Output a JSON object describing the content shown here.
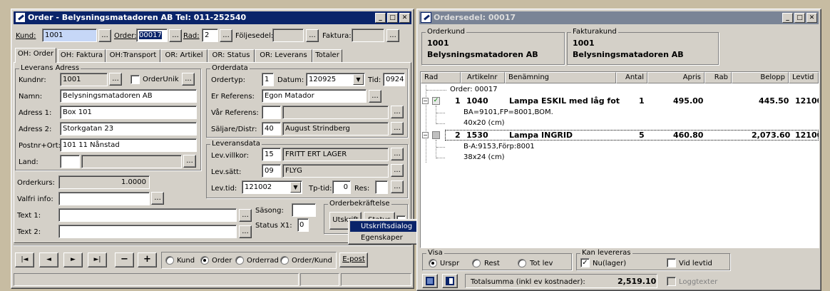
{
  "order_window": {
    "title": "Order - Belysningsmatadoren AB  Tel: 011-252540",
    "kund_label": "Kund:",
    "kund_value": "1001",
    "order_label": "Order:",
    "order_value": "00017",
    "rad_label": "Rad:",
    "rad_value": "2",
    "foljesedel_label": "Följesedel:",
    "faktura_label": "Faktura:",
    "tabs": [
      "OH: Order",
      "OH: Faktura",
      "OH:Transport",
      "OR: Artikel",
      "OR: Status",
      "OR: Leverans",
      "Totaler"
    ],
    "leverans": {
      "title": "Leverans Adress",
      "kundnr_label": "Kundnr:",
      "kundnr": "1001",
      "orderunik_label": "OrderUnik",
      "namn_label": "Namn:",
      "namn": "Belysningsmatadoren AB",
      "adress1_label": "Adress 1:",
      "adress1": "Box 101",
      "adress2_label": "Adress 2:",
      "adress2": "Storkgatan 23",
      "postnr_label": "Postnr+Ort:",
      "postnr": "101 11  Nånstad",
      "land_label": "Land:"
    },
    "orderdata": {
      "title": "Orderdata",
      "ordertyp_label": "Ordertyp:",
      "ordertyp": "1",
      "datum_label": "Datum:",
      "datum": "120925",
      "tid_label": "Tid:",
      "tid": "0924",
      "erref_label": "Er Referens:",
      "erref": "Egon Matador",
      "varref_label": "Vår Referens:",
      "saljare_label": "Säljare/Distr:",
      "saljare_code": "40",
      "saljare_name": "August Strindberg"
    },
    "leveransdata": {
      "title": "Leveransdata",
      "villkor_label": "Lev.villkor:",
      "villkor_code": "15",
      "villkor_name": "FRITT ERT LAGER",
      "satt_label": "Lev.sätt:",
      "satt_code": "09",
      "satt_name": "FLYG",
      "levtid_label": "Lev.tid:",
      "levtid": "121002",
      "tptid_label": "Tp-tid:",
      "tptid": "0",
      "res_label": "Res:"
    },
    "orderkurs_label": "Orderkurs:",
    "orderkurs": "1.0000",
    "valfri_label": "Valfri info:",
    "text1_label": "Text 1:",
    "text2_label": "Text 2:",
    "sasong_label": "Säsong:",
    "status_label": "Status X1:",
    "status_value": "0",
    "orderbekraftelse_title": "Orderbekräftelse",
    "utskrift_label": "Utskrift",
    "status_btn": "Status",
    "context_menu": [
      "Utskriftsdialog",
      "Egenskaper"
    ],
    "bottom": {
      "radios": [
        "Kund",
        "Order",
        "Orderrad",
        "Order/Kund"
      ],
      "selected": "Order",
      "epost": "E-post",
      "nav": [
        "|◄",
        "◄",
        "►",
        "►|"
      ],
      "minus": "−",
      "plus": "+"
    }
  },
  "ordersedel_window": {
    "title": "Ordersedel: 00017",
    "orderkund_title": "Orderkund",
    "orderkund_nr": "1001",
    "orderkund_name": "Belysningsmatadoren AB",
    "fakturakund_title": "Fakturakund",
    "fakturakund_nr": "1001",
    "fakturakund_name": "Belysningsmatadoren AB",
    "columns": [
      "Rad",
      "Artikelnr",
      "Benämning",
      "Antal",
      "Apris",
      "Rab",
      "Belopp",
      "Levtid"
    ],
    "order_line": "Order: 00017",
    "rows": [
      {
        "rad": "1",
        "artnr": "1040",
        "benamning": "Lampa ESKIL med låg fot",
        "antal": "1",
        "apris": "495.00",
        "belopp": "445.50",
        "levtid": "12100",
        "details": [
          "BA=9101,FP=8001,BOM.",
          "40x20 (cm)"
        ]
      },
      {
        "rad": "2",
        "artnr": "1530",
        "benamning": "Lampa INGRID",
        "antal": "5",
        "apris": "460.80",
        "belopp": "2,073.60",
        "levtid": "12100",
        "details": [
          "B-A:9153,Förp:8001",
          "38x24 (cm)"
        ]
      }
    ],
    "visa_title": "Visa",
    "visa_options": [
      "Urspr",
      "Rest",
      "Tot lev"
    ],
    "visa_selected": "Urspr",
    "kan_title": "Kan levereras",
    "nulager_label": "Nu(lager)",
    "vidlevtid_label": "Vid levtid",
    "totalsumma_label": "Totalsumma (inkl ev kostnader):",
    "totalsumma": "2,519.10",
    "loggtexter_label": "Loggtexter"
  }
}
